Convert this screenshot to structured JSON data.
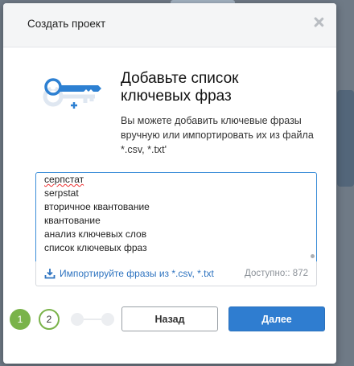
{
  "dialog": {
    "title": "Создать проект"
  },
  "content": {
    "heading": "Добавьте список ключевых фраз",
    "description": "Вы можете добавить ключевые фразы вручную или импортировать их из файла *.csv, *.txt'"
  },
  "phrases": [
    "серпстат",
    "serpstat",
    "вторичное квантование",
    "квантование",
    "анализ ключевых слов",
    "список ключевых фраз"
  ],
  "import": {
    "link_label": "Импортируйте фразы из *.csv, *.txt",
    "available_label": "Доступно:: 872"
  },
  "steps": {
    "step1": "1",
    "step2": "2"
  },
  "buttons": {
    "back": "Назад",
    "next": "Далее"
  },
  "colors": {
    "accent": "#2f7dd0",
    "step_active": "#7ab34a",
    "link": "#2f74c0"
  }
}
